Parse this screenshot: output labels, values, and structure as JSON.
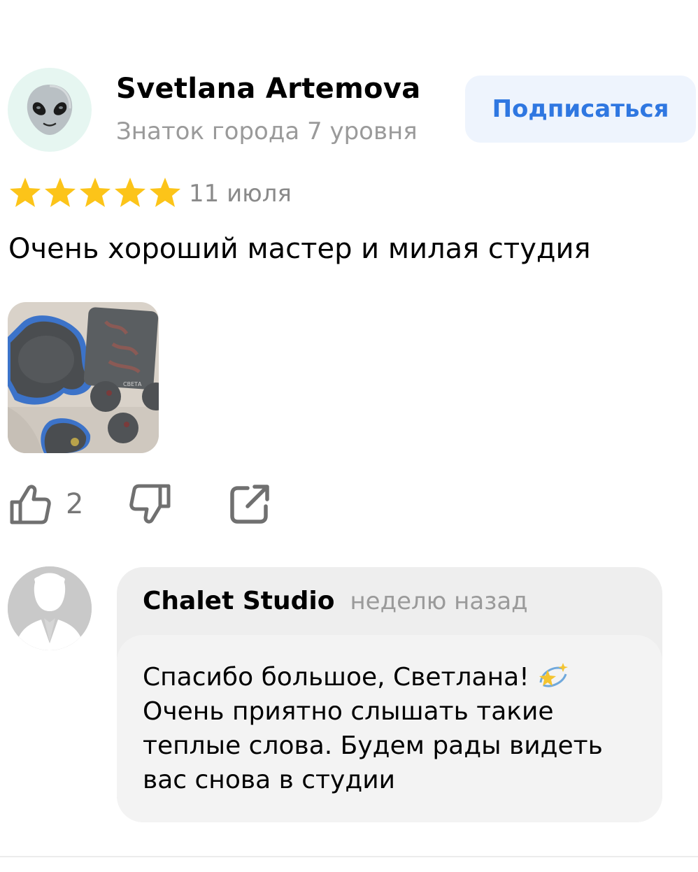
{
  "review": {
    "author_name": "Svetlana Artemova",
    "author_level": "Знаток города 7 уровня",
    "subscribe_label": "Подписаться",
    "rating": 5,
    "date": "11 июля",
    "text": "Очень хороший мастер и милая студия",
    "photo_caption": "СВЕТА",
    "likes": "2"
  },
  "icons": {
    "avatar": "alien-emoji-icon",
    "star": "star-icon",
    "like": "thumbs-up-icon",
    "dislike": "thumbs-down-icon",
    "share": "share-icon",
    "sparkle": "sparkle-star-emoji-icon"
  },
  "reply": {
    "author": "Chalet Studio",
    "time": "неделю назад",
    "lines": [
      "Спасибо большое, Светлана!",
      "Очень приятно слышать такие",
      "теплые слова. Будем рады видеть",
      "вас снова в студии"
    ]
  },
  "colors": {
    "accent": "#2f77e1",
    "star": "#fcc419",
    "muted": "#9a9a9a"
  }
}
